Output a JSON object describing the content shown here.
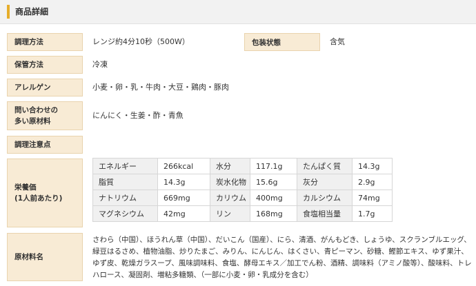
{
  "header": {
    "title": "商品詳細"
  },
  "rows": {
    "cooking": {
      "label": "調理方法",
      "value": "レンジ約4分10秒（500W）"
    },
    "packaging": {
      "label": "包装状態",
      "value": "含気"
    },
    "storage": {
      "label": "保管方法",
      "value": "冷凍"
    },
    "allergen": {
      "label": "アレルゲン",
      "value": "小麦・卵・乳・牛肉・大豆・鶏肉・豚肉"
    },
    "inquiry": {
      "label_line1": "問い合わせの",
      "label_line2": "多い原材料",
      "value": "にんにく・生姜・酢・青魚"
    },
    "caution": {
      "label": "調理注意点",
      "value": ""
    },
    "nutrition": {
      "label_line1": "栄養価",
      "label_line2": "(1人前あたり)",
      "rows": [
        [
          {
            "k": "エネルギー",
            "v": "266kcal"
          },
          {
            "k": "水分",
            "v": "117.1g"
          },
          {
            "k": "たんぱく質",
            "v": "14.3g"
          }
        ],
        [
          {
            "k": "脂質",
            "v": "14.3g"
          },
          {
            "k": "炭水化物",
            "v": "15.6g"
          },
          {
            "k": "灰分",
            "v": "2.9g"
          }
        ],
        [
          {
            "k": "ナトリウム",
            "v": "669mg"
          },
          {
            "k": "カリウム",
            "v": "400mg"
          },
          {
            "k": "カルシウム",
            "v": "74mg"
          }
        ],
        [
          {
            "k": "マグネシウム",
            "v": "42mg"
          },
          {
            "k": "リン",
            "v": "168mg"
          },
          {
            "k": "食塩相当量",
            "v": "1.7g"
          }
        ]
      ]
    },
    "ingredients": {
      "label": "原材料名",
      "value": "さわら（中国）、ほうれん草（中国）、だいこん（国産）、にら、清酒、がんもどき、しょうゆ、スクランブルエッグ、緑豆はるさめ、植物油脂、炒りたまご、みりん、にんじん、はくさい、青ピーマン、砂糖、鰹節エキス、ゆず果汁、ゆず皮、乾燥ガラスープ、風味調味料、食塩、酵母エキス／加工でん粉、酒精、調味料（アミノ酸等）、酸味料、トレハロース、凝固剤、増粘多糖類、（一部に小麦・卵・乳成分を含む）"
    }
  }
}
